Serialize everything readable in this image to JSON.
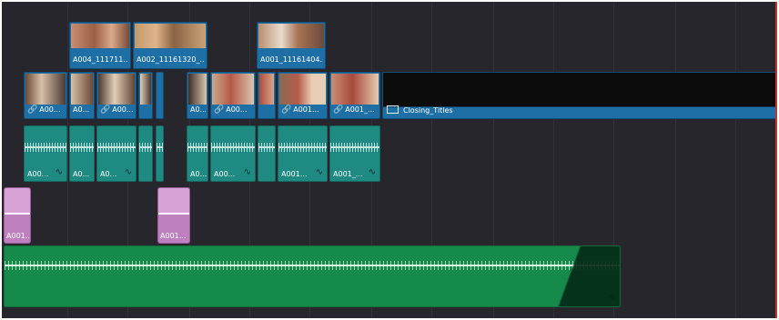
{
  "timeline": {
    "video_track_2": [
      {
        "label": "A004_111711..."
      },
      {
        "label": "A002_11161320_..."
      },
      {
        "label": "A001_11161404..."
      }
    ],
    "video_track_1": [
      {
        "label": "A00...",
        "linked": true
      },
      {
        "label": "A0...",
        "linked": false
      },
      {
        "label": "A00...",
        "linked": true
      },
      {
        "label": "",
        "linked": false
      },
      {
        "label": "",
        "linked": false
      },
      {
        "label": "A0...",
        "linked": false
      },
      {
        "label": "A00...",
        "linked": true
      },
      {
        "label": "",
        "linked": false
      },
      {
        "label": "A001...",
        "linked": true
      },
      {
        "label": "A001_...",
        "linked": true
      }
    ],
    "title_clip": {
      "label": "Closing_Titles"
    },
    "audio_track_1": [
      {
        "label": "A00..."
      },
      {
        "label": "A0..."
      },
      {
        "label": "A0..."
      },
      {
        "label": ""
      },
      {
        "label": ""
      },
      {
        "label": "A0..."
      },
      {
        "label": "A00..."
      },
      {
        "label": ""
      },
      {
        "label": "A001..."
      },
      {
        "label": "A001_..."
      }
    ],
    "audio_track_2": [
      {
        "label": "A001..."
      },
      {
        "label": "A001..."
      }
    ],
    "music_track": {
      "label": ""
    },
    "colors": {
      "background": "#26262c",
      "video_clip": "#1d6fa5",
      "audio_clip": "#1f8a82",
      "pink_clip": "#d7a3d6",
      "music_clip": "#158a4a",
      "playhead": "#c0392b"
    }
  }
}
